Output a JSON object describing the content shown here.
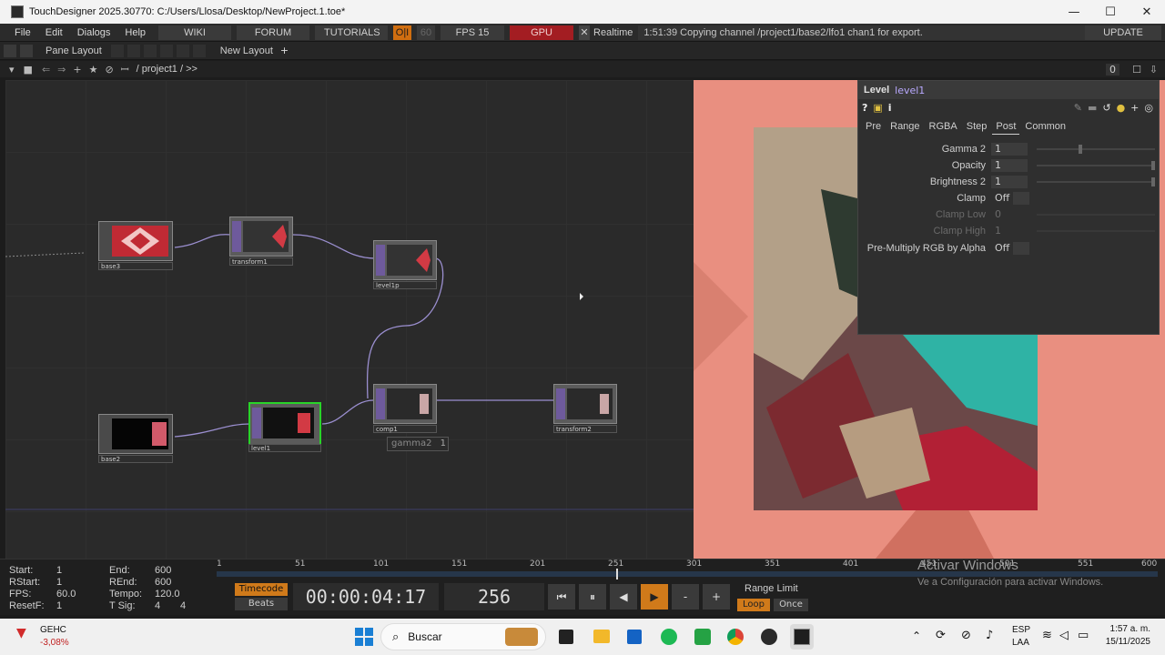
{
  "window": {
    "title": "TouchDesigner 2025.30770: C:/Users/Llosa/Desktop/NewProject.1.toe*",
    "minimize": "—",
    "maximize": "☐",
    "close": "✕"
  },
  "menubar": {
    "items": [
      "File",
      "Edit",
      "Dialogs",
      "Help"
    ],
    "wiki": "WIKI",
    "forum": "FORUM",
    "tutorials": "TUTORIALS",
    "oi": "O|I",
    "fps_value_dim": "60",
    "fps": "FPS  15",
    "gpu": "GPU",
    "realtime_check": "✕",
    "realtime": "Realtime",
    "status": "1:51:39 Copying channel /project1/base2/lfo1 chan1 for export.",
    "update": "UPDATE"
  },
  "panerow": {
    "pane_layout": "Pane Layout",
    "new_layout": "New Layout",
    "plus": "+"
  },
  "pathrow": {
    "path": "/ project1 / >>",
    "zero": "0"
  },
  "nodes": [
    {
      "label": "base3"
    },
    {
      "label": "transform1"
    },
    {
      "label": "level1p"
    },
    {
      "label": "comp1"
    },
    {
      "label": "transform2"
    },
    {
      "label": "base2"
    },
    {
      "label": "level1"
    }
  ],
  "gamma_overlay": {
    "label": "gamma2",
    "value": "1"
  },
  "params": {
    "op_type": "Level",
    "op_name": "level1",
    "tabs": [
      "Pre",
      "Range",
      "RGBA",
      "Step",
      "Post",
      "Common"
    ],
    "active_tab": "Post",
    "rows": [
      {
        "label": "Gamma 2",
        "value": "1"
      },
      {
        "label": "Opacity",
        "value": "1"
      },
      {
        "label": "Brightness 2",
        "value": "1"
      },
      {
        "label": "Clamp",
        "value": "Off"
      },
      {
        "label": "Clamp Low",
        "value": "0"
      },
      {
        "label": "Clamp High",
        "value": "1"
      },
      {
        "label": "Pre-Multiply RGB by Alpha",
        "value": "Off"
      }
    ]
  },
  "timeline": {
    "start_label": "Start:",
    "start": "1",
    "end_label": "End:",
    "end": "600",
    "rstart_label": "RStart:",
    "rstart": "1",
    "rend_label": "REnd:",
    "rend": "600",
    "fps_label": "FPS:",
    "fps": "60.0",
    "tempo_label": "Tempo:",
    "tempo": "120.0",
    "resetf_label": "ResetF:",
    "resetf": "1",
    "tsig_label": "T Sig:",
    "tsig_a": "4",
    "tsig_b": "4",
    "ruler": [
      "1",
      "51",
      "101",
      "151",
      "201",
      "251",
      "301",
      "351",
      "401",
      "451",
      "501",
      "551",
      "600"
    ],
    "timecode": "Timecode",
    "beats": "Beats",
    "time": "00:00:04:17",
    "frame": "256",
    "minus": "-",
    "plus": "+",
    "range_limit": "Range Limit",
    "loop": "Loop",
    "once": "Once"
  },
  "watermark": {
    "title": "Activar Windows",
    "subtitle": "Ve a Configuración para activar Windows."
  },
  "taskbar": {
    "stock_name": "GEHC",
    "stock_change": "-3,08%",
    "search": "Buscar",
    "lang": "ESP",
    "lang2": "LAA",
    "time": "1:57 a. m.",
    "date": "15/11/2025"
  },
  "colors": {
    "gpu_red": "#a31d22",
    "oi_orange": "#d06e10",
    "selected_green": "#29d429",
    "port_purple": "#6e5a9c",
    "viewer_pink": "#e98f80",
    "accent_timecode": "#d07a1a"
  }
}
